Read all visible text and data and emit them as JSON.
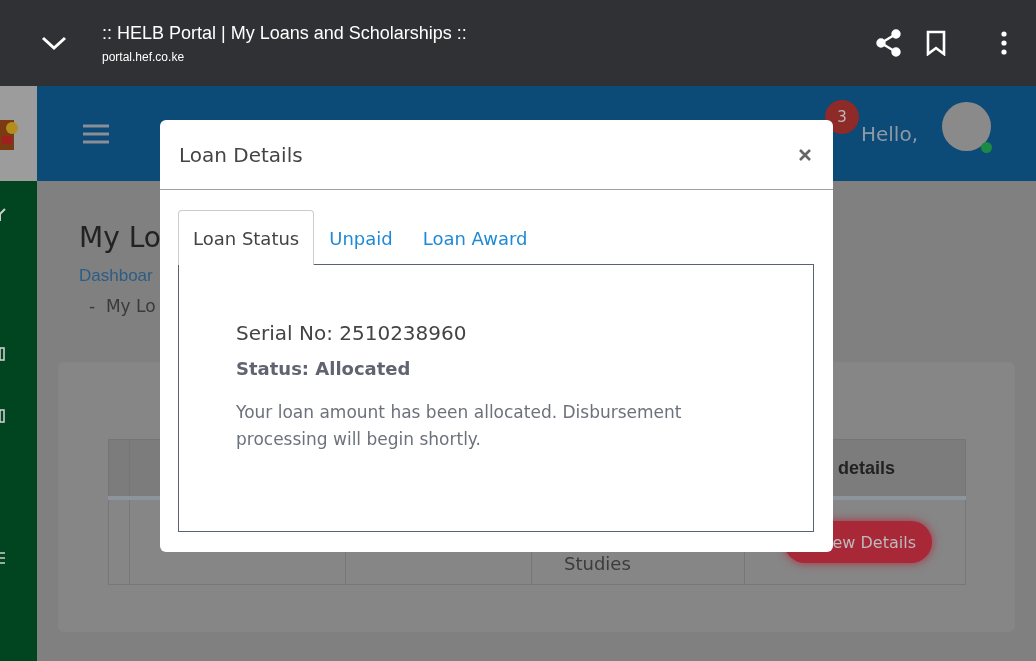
{
  "browser": {
    "title": ":: HELB Portal | My Loans and Scholarships ::",
    "url": "portal.hef.co.ke"
  },
  "header": {
    "notification_count": "3",
    "greeting": "Hello,"
  },
  "page": {
    "title": "My Lo",
    "breadcrumb_link": "Dashboar",
    "breadcrumb_current": "-  My Lo"
  },
  "table": {
    "column_5": "details",
    "rows": [
      {
        "column_4": "Studies",
        "action": "ew Details"
      }
    ]
  },
  "modal": {
    "title": "Loan Details",
    "tabs": [
      {
        "label": "Loan Status",
        "selected": true
      },
      {
        "label": "Unpaid",
        "selected": false
      },
      {
        "label": "Loan Award",
        "selected": false
      }
    ],
    "serial": "Serial No: 2510238960",
    "status": "Status: Allocated",
    "message": "Your loan amount has been allocated. Disbursement processing will begin shortly."
  }
}
